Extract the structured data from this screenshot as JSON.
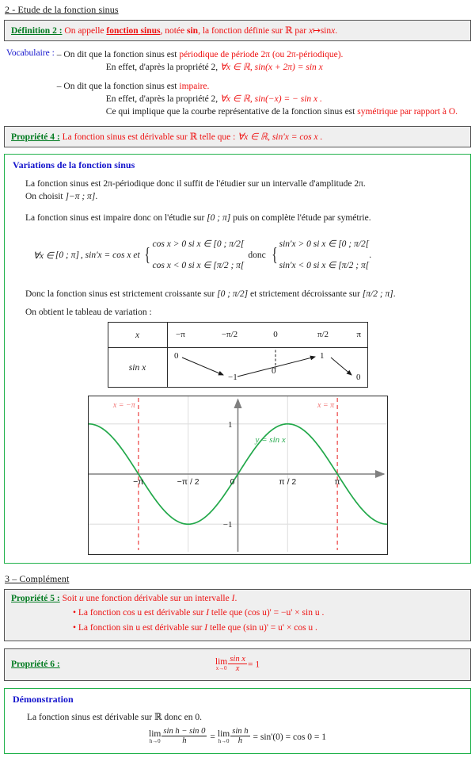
{
  "section2": {
    "heading": "2 - Etude de la fonction sinus"
  },
  "definition2": {
    "label": "Définition 2 :",
    "text_a": "On appelle ",
    "emph": "fonction sinus",
    "text_b": ", notée ",
    "notation": "sin",
    "text_c": ", la fonction définie sur ",
    "set": "ℝ",
    "text_d": " par ",
    "map_x": "x",
    "map_arrow": "↦",
    "map_sin": "sin",
    "map_var": "x",
    "period": "."
  },
  "vocabulaire": {
    "label": "Vocabulaire :",
    "item1_dash": "–",
    "item1_a": "On dit que la fonction sinus est ",
    "item1_red": "périodique de période 2π (ou 2π-périodique).",
    "item1_line2_black": "En effet, d'après la propriété 2, ",
    "item1_line2_red": "∀x ∈ ℝ, sin(x + 2π) = sin x",
    "item2_dash": "–",
    "item2_a": "On dit que la fonction sinus est ",
    "item2_red": "impaire.",
    "item2_line2_black": "En effet, d'après la propriété 2, ",
    "item2_line2_red": "∀x ∈ ℝ, sin(−x) = − sin x .",
    "item2_line3_black": "Ce qui implique que la courbe représentative de la fonction sinus est ",
    "item2_line3_red": "symétrique par rapport à O."
  },
  "propriete4": {
    "label": "Propriété 4 :",
    "text_a": "La fonction sinus est dérivable sur ",
    "set": "ℝ",
    "text_b": " telle que : ",
    "formula": "∀x ∈ ℝ, sin'x = cos x .",
    "set2": "ℝ"
  },
  "variations": {
    "title": "Variations de la fonction sinus",
    "p1_line1": "La fonction sinus est 2π-périodique donc il suffit de l'étudier sur un intervalle d'amplitude 2π.",
    "p1_line2_a": "On choisit ",
    "p1_line2_interval": "]−π ; π]",
    "p1_line2_b": ".",
    "p2_a": "La fonction sinus est impaire donc on l'étudie sur ",
    "p2_interval": "[0 ; π]",
    "p2_b": " puis on complète l'étude par symétrie.",
    "sys_prefix_a": "∀x ∈",
    "sys_prefix_interval": "[0 ; π]",
    "sys_prefix_b": ", sin'x = cos x  et",
    "sys_left_1_a": "cos x > 0  si  x ∈",
    "sys_left_1_i": "[0 ; π/2[",
    "sys_left_2_a": "cos x < 0  si  x ∈",
    "sys_left_2_i": "[π/2 ; π[",
    "donc": "donc",
    "sys_right_1_a": "sin'x > 0  si  x ∈",
    "sys_right_1_i": "[0 ; π/2[",
    "sys_right_2_a": "sin'x < 0  si  x ∈",
    "sys_right_2_i": "[π/2 ; π[",
    "sys_period": ".",
    "concl_a": "Donc la fonction sinus est strictement croissante sur ",
    "concl_i1": "[0 ; π/2]",
    "concl_b": " et strictement décroissante sur ",
    "concl_i2": "[π/2 ; π]",
    "concl_c": ".",
    "tableau_intro": "On obtient le tableau de variation :"
  },
  "variation_table": {
    "row_x_label": "x",
    "row_sin_label": "sin x",
    "x_values": [
      "−π",
      "−π/2",
      "0",
      "π/2",
      "π"
    ],
    "sin_values": [
      "0",
      "−1",
      "0",
      "1",
      "0"
    ]
  },
  "chart_data": {
    "type": "line",
    "title": "",
    "xlabel": "",
    "ylabel": "",
    "curve_label": "y = sin x",
    "function": "sin",
    "xlim": [
      -4.712,
      4.712
    ],
    "ylim": [
      -1.55,
      1.55
    ],
    "x_ticks": [
      -3.1416,
      -1.5708,
      0,
      1.5708,
      3.1416
    ],
    "x_tick_labels": [
      "−π",
      "−π / 2",
      "0",
      "π / 2",
      "π"
    ],
    "y_ticks": [
      -1,
      1
    ],
    "y_tick_labels": [
      "−1",
      "1"
    ],
    "grid": true,
    "curve_color": "#22a84a",
    "axis_color": "#808080",
    "grid_color": "#e2e2e2",
    "vlines": [
      {
        "x": -3.1416,
        "label": "x = −π",
        "color": "#f07070"
      },
      {
        "x": 3.1416,
        "label": "x = π",
        "color": "#f07070"
      }
    ],
    "series": [
      {
        "name": "y = sin x",
        "x": [
          -4.712,
          -4.4,
          -4.0,
          -3.6,
          -3.1416,
          -2.8,
          -2.4,
          -2.0,
          -1.5708,
          -1.2,
          -0.8,
          -0.4,
          0,
          0.4,
          0.8,
          1.2,
          1.5708,
          2.0,
          2.4,
          2.8,
          3.1416,
          3.6,
          4.0,
          4.4,
          4.712
        ],
        "y": [
          1.0,
          0.951,
          0.757,
          0.443,
          0.0,
          -0.335,
          -0.675,
          -0.909,
          -1.0,
          -0.932,
          -0.717,
          -0.389,
          0.0,
          0.389,
          0.717,
          0.932,
          1.0,
          0.909,
          0.675,
          0.335,
          0.0,
          -0.443,
          -0.757,
          -0.951,
          -1.0
        ]
      }
    ]
  },
  "section3": {
    "heading": "3 – Complément"
  },
  "propriete5": {
    "label": "Propriété 5 :",
    "intro_a": "Soit ",
    "intro_u": "u",
    "intro_b": " une fonction dérivable sur un intervalle ",
    "intro_i": "I",
    "intro_c": ".",
    "bullet1_a": "La fonction  cos u  est dérivable sur ",
    "bullet1_i": "I",
    "bullet1_b": " telle que (cos u)' = −u' × sin u .",
    "bullet2_a": "La fonction  sin u  est dérivable sur ",
    "bullet2_i": "I",
    "bullet2_b": " telle que (sin u)' = u' × cos u ."
  },
  "propriete6": {
    "label": "Propriété 6 :",
    "lim_word": "lim",
    "lim_sub": "x→0",
    "frac_num": "sin x",
    "frac_den": "x",
    "equals": "= 1"
  },
  "demonstration": {
    "title": "Démonstration",
    "line1_a": "La fonction sinus est dérivable sur ",
    "line1_set": "ℝ",
    "line1_b": " donc en 0.",
    "lim_word": "lim",
    "lim_sub": "h→0",
    "f1_num": "sin h − sin 0",
    "f1_den": "h",
    "eq1": "=",
    "f2_num": "sin h",
    "f2_den": "h",
    "tail": "= sin'(0) = cos 0 = 1"
  }
}
